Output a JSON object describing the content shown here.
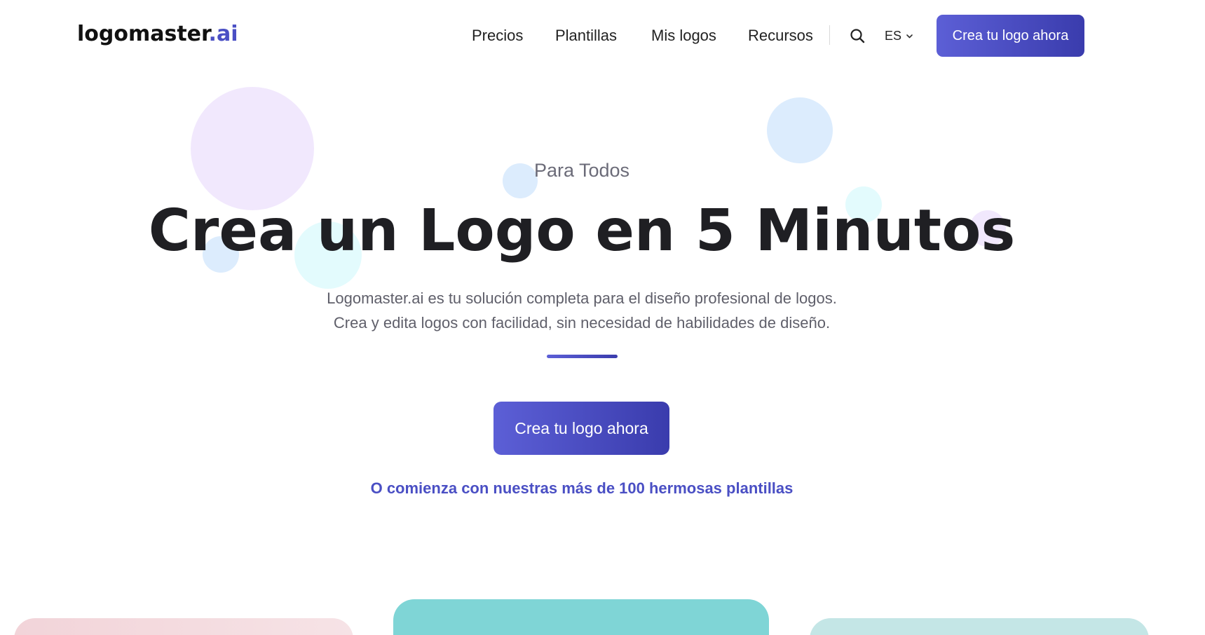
{
  "header": {
    "logo_main": "logomaster",
    "logo_tld": ".ai",
    "nav": [
      "Precios",
      "Plantillas",
      "Mis logos",
      "Recursos"
    ],
    "language": "ES",
    "cta_label": "Crea tu logo ahora"
  },
  "hero": {
    "eyebrow": "Para Todos",
    "headline": "Crea un Logo en 5 Minutos",
    "subtext_line1": "Logomaster.ai es tu solución completa para el diseño profesional de logos.",
    "subtext_line2": "Crea y edita logos con facilidad, sin necesidad de habilidades de diseño.",
    "cta_label": "Crea tu logo ahora",
    "templates_link": "O comienza con nuestras más de 100 hermosas plantillas"
  },
  "colors": {
    "accent": "#4a4fc4",
    "button_gradient_start": "#5c5fd6",
    "button_gradient_end": "#3a3cad",
    "card_left": "#f4d6dc",
    "card_center": "#7fd5d6",
    "card_right": "#c4e6e6"
  },
  "icons": {
    "search": "search-icon",
    "language_caret": "chevron-down-icon"
  }
}
